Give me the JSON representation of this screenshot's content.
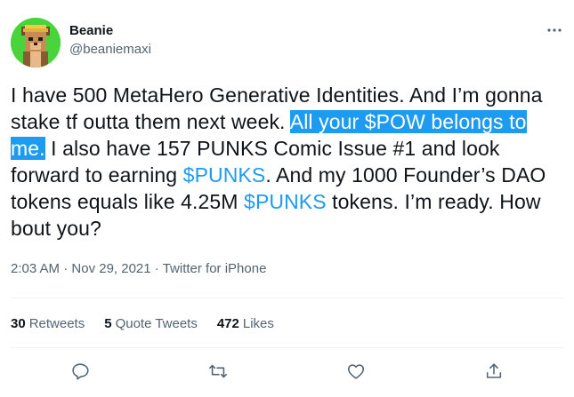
{
  "author": {
    "name": "Beanie",
    "handle": "@beaniemaxi",
    "avatar_bg": "#4ad43c"
  },
  "more_icon": "more-horizontal-icon",
  "tweet": {
    "t1": "I have 500 MetaHero Generative Identities. And I’m gonna stake tf outta them next week. ",
    "t_selected": "All your $POW belongs to me.",
    "t2": " I also have 157 PUNKS Comic Issue #1 and look forward to earning ",
    "cashtag1": "$PUNKS",
    "t3": ". And my 1000 Founder’s DAO tokens equals like 4.25M ",
    "cashtag2": "$PUNKS",
    "t4": " tokens. I’m ready. How bout you?"
  },
  "meta": {
    "time": "2:03 AM",
    "sep1": " · ",
    "date": "Nov 29, 2021",
    "sep2": " · ",
    "source": "Twitter for iPhone"
  },
  "stats": {
    "retweets_count": "30",
    "retweets_label": "Retweets",
    "quotes_count": "5",
    "quotes_label": "Quote Tweets",
    "likes_count": "472",
    "likes_label": "Likes"
  },
  "actions": [
    "reply-icon",
    "retweet-icon",
    "like-icon",
    "share-icon"
  ],
  "colors": {
    "accent": "#1d9bf0",
    "muted": "#536471",
    "text": "#0f1419"
  }
}
